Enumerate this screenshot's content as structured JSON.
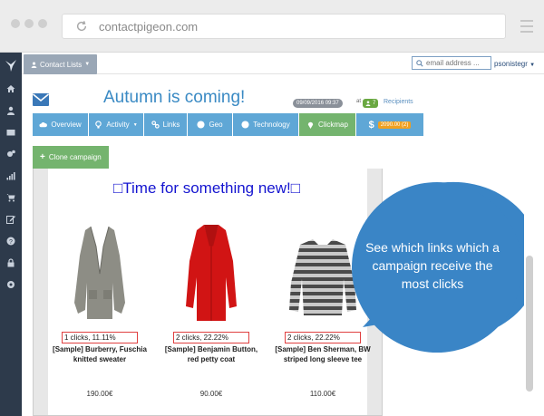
{
  "browser": {
    "url": "contactpigeon.com"
  },
  "topbar": {
    "contact_lists_label": "Contact Lists",
    "email_placeholder": "email address ...",
    "username": "psonistegr"
  },
  "sidebar": {
    "items": [
      "home-icon",
      "user-icon",
      "envelope-icon",
      "cogs-icon",
      "signal-icon",
      "cart-icon",
      "edit-icon",
      "question-icon",
      "lock-icon",
      "circle-icon"
    ]
  },
  "campaign": {
    "title": "Autumn is coming!",
    "date": "09/09/2016 09:37",
    "at": "at",
    "recipients_count": "7",
    "recipients_label": "Recipients"
  },
  "tabs": [
    {
      "label": "Overview",
      "icon": "cloud-icon"
    },
    {
      "label": "Activity",
      "icon": "lightbulb-icon"
    },
    {
      "label": "Links",
      "icon": "link-icon"
    },
    {
      "label": "Geo",
      "icon": "globe-icon"
    },
    {
      "label": "Technology",
      "icon": "globe-icon"
    },
    {
      "label": "Clickmap",
      "icon": "map-marker-icon"
    },
    {
      "label": "2090.00 (2)",
      "icon": "dollar-icon"
    }
  ],
  "clone_label": "Clone campaign",
  "email": {
    "headline": "□Time for something new!□",
    "products": [
      {
        "clicks": "1 clicks, 11.11%",
        "name": "[Sample] Burberry, Fuschia knitted sweater",
        "price": "190.00€"
      },
      {
        "clicks": "2 clicks, 22.22%",
        "name": "[Sample] Benjamin Button, red petty coat",
        "price": "90.00€"
      },
      {
        "clicks": "2 clicks, 22.22%",
        "name": "[Sample] Ben Sherman, BW striped long sleeve tee",
        "price": "110.00€"
      }
    ]
  },
  "callout": {
    "text": "See which links which a campaign receive the most clicks"
  },
  "colors": {
    "sidebar": "#2d3a4b",
    "tab_blue": "#5fa7d6",
    "tab_green": "#74b46e",
    "callout": "#3a85c6",
    "title_blue": "#3a8ac4"
  }
}
